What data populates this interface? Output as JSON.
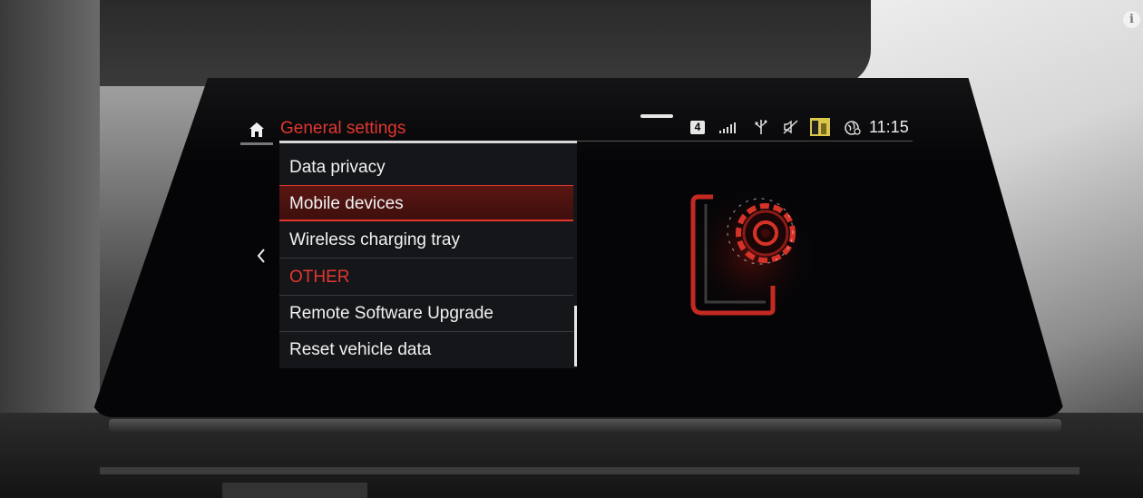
{
  "header": {
    "title": "General settings",
    "home_icon": "home-icon"
  },
  "status_bar": {
    "network_badge": "4",
    "icons": [
      "signal-bars-icon",
      "usb-icon",
      "mute-icon",
      "profile-icon",
      "globe-icon"
    ],
    "time": "11:15"
  },
  "menu": {
    "items": [
      {
        "label": "Data privacy",
        "selected": false
      },
      {
        "label": "Mobile devices",
        "selected": true
      },
      {
        "label": "Wireless charging tray",
        "selected": false
      },
      {
        "label": "OTHER",
        "section": true
      },
      {
        "label": "Remote Software Upgrade",
        "selected": false
      },
      {
        "label": "Reset vehicle data",
        "selected": false
      }
    ]
  },
  "info_badge": "i",
  "colors": {
    "accent": "#e2372f",
    "text": "#f2f2f2",
    "panel": "#15161a",
    "screen": "#050507"
  }
}
